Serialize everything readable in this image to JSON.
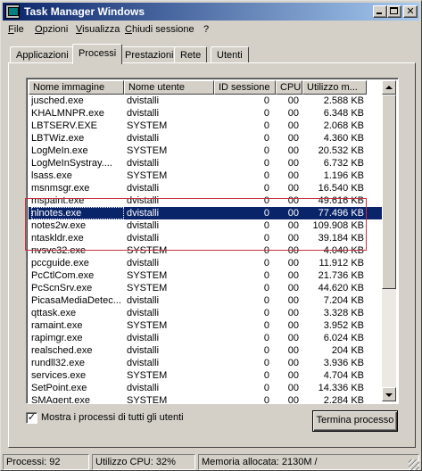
{
  "window": {
    "title": "Task Manager Windows"
  },
  "menu": [
    {
      "label": "File"
    },
    {
      "label": "Opzioni"
    },
    {
      "label": "Visualizza"
    },
    {
      "label": "Chiudi sessione"
    },
    {
      "label": "?"
    }
  ],
  "tabs": [
    {
      "label": "Applicazioni"
    },
    {
      "label": "Processi"
    },
    {
      "label": "Prestazioni"
    },
    {
      "label": "Rete"
    },
    {
      "label": "Utenti"
    }
  ],
  "active_tab": "Processi",
  "columns": [
    {
      "label": "Nome immagine"
    },
    {
      "label": "Nome utente"
    },
    {
      "label": "ID sessione"
    },
    {
      "label": "CPU"
    },
    {
      "label": "Utilizzo m..."
    }
  ],
  "processes": [
    {
      "name": "jusched.exe",
      "user": "dvistalli",
      "session": "0",
      "cpu": "00",
      "mem": "2.588 KB"
    },
    {
      "name": "KHALMNPR.exe",
      "user": "dvistalli",
      "session": "0",
      "cpu": "00",
      "mem": "6.348 KB"
    },
    {
      "name": "LBTSERV.EXE",
      "user": "SYSTEM",
      "session": "0",
      "cpu": "00",
      "mem": "2.068 KB"
    },
    {
      "name": "LBTWiz.exe",
      "user": "dvistalli",
      "session": "0",
      "cpu": "00",
      "mem": "4.360 KB"
    },
    {
      "name": "LogMeIn.exe",
      "user": "SYSTEM",
      "session": "0",
      "cpu": "00",
      "mem": "20.532 KB"
    },
    {
      "name": "LogMeInSystray....",
      "user": "dvistalli",
      "session": "0",
      "cpu": "00",
      "mem": "6.732 KB"
    },
    {
      "name": "lsass.exe",
      "user": "SYSTEM",
      "session": "0",
      "cpu": "00",
      "mem": "1.196 KB"
    },
    {
      "name": "msnmsgr.exe",
      "user": "dvistalli",
      "session": "0",
      "cpu": "00",
      "mem": "16.540 KB"
    },
    {
      "name": "mspaint.exe",
      "user": "dvistalli",
      "session": "0",
      "cpu": "00",
      "mem": "49.616 KB"
    },
    {
      "name": "nlnotes.exe",
      "user": "dvistalli",
      "session": "0",
      "cpu": "00",
      "mem": "77.496 KB"
    },
    {
      "name": "notes2w.exe",
      "user": "dvistalli",
      "session": "0",
      "cpu": "00",
      "mem": "109.908 KB"
    },
    {
      "name": "ntaskldr.exe",
      "user": "dvistalli",
      "session": "0",
      "cpu": "00",
      "mem": "39.184 KB"
    },
    {
      "name": "nvsvc32.exe",
      "user": "SYSTEM",
      "session": "0",
      "cpu": "00",
      "mem": "4.040 KB"
    },
    {
      "name": "pccguide.exe",
      "user": "dvistalli",
      "session": "0",
      "cpu": "00",
      "mem": "11.912 KB"
    },
    {
      "name": "PcCtlCom.exe",
      "user": "SYSTEM",
      "session": "0",
      "cpu": "00",
      "mem": "21.736 KB"
    },
    {
      "name": "PcScnSrv.exe",
      "user": "SYSTEM",
      "session": "0",
      "cpu": "00",
      "mem": "44.620 KB"
    },
    {
      "name": "PicasaMediaDetec...",
      "user": "dvistalli",
      "session": "0",
      "cpu": "00",
      "mem": "7.204 KB"
    },
    {
      "name": "qttask.exe",
      "user": "dvistalli",
      "session": "0",
      "cpu": "00",
      "mem": "3.328 KB"
    },
    {
      "name": "ramaint.exe",
      "user": "SYSTEM",
      "session": "0",
      "cpu": "00",
      "mem": "3.952 KB"
    },
    {
      "name": "rapimgr.exe",
      "user": "dvistalli",
      "session": "0",
      "cpu": "00",
      "mem": "6.024 KB"
    },
    {
      "name": "realsched.exe",
      "user": "dvistalli",
      "session": "0",
      "cpu": "00",
      "mem": "204 KB"
    },
    {
      "name": "rundll32.exe",
      "user": "dvistalli",
      "session": "0",
      "cpu": "00",
      "mem": "3.936 KB"
    },
    {
      "name": "services.exe",
      "user": "SYSTEM",
      "session": "0",
      "cpu": "00",
      "mem": "4.704 KB"
    },
    {
      "name": "SetPoint.exe",
      "user": "dvistalli",
      "session": "0",
      "cpu": "00",
      "mem": "14.336 KB"
    },
    {
      "name": "SMAgent.exe",
      "user": "SYSTEM",
      "session": "0",
      "cpu": "00",
      "mem": "2.284 KB"
    }
  ],
  "selected_process": "nlnotes.exe",
  "show_all_processes": {
    "label": "Mostra i processi di tutti gli utenti",
    "checked": true,
    "check_glyph": "✓"
  },
  "end_process_button": {
    "label": "Termina processo"
  },
  "status": {
    "processes": "Processi: 92",
    "cpu": "Utilizzo CPU: 32%",
    "memory": "Memoria allocata: 2130M /"
  },
  "colors": {
    "highlight_box": "#c83040",
    "selection": "#0a246a",
    "titlebar_start": "#0a246a",
    "titlebar_end": "#a6caf0"
  },
  "icons": {
    "app": "task-manager-icon",
    "minimize": "minimize-icon",
    "maximize": "maximize-icon",
    "close": "close-icon"
  }
}
